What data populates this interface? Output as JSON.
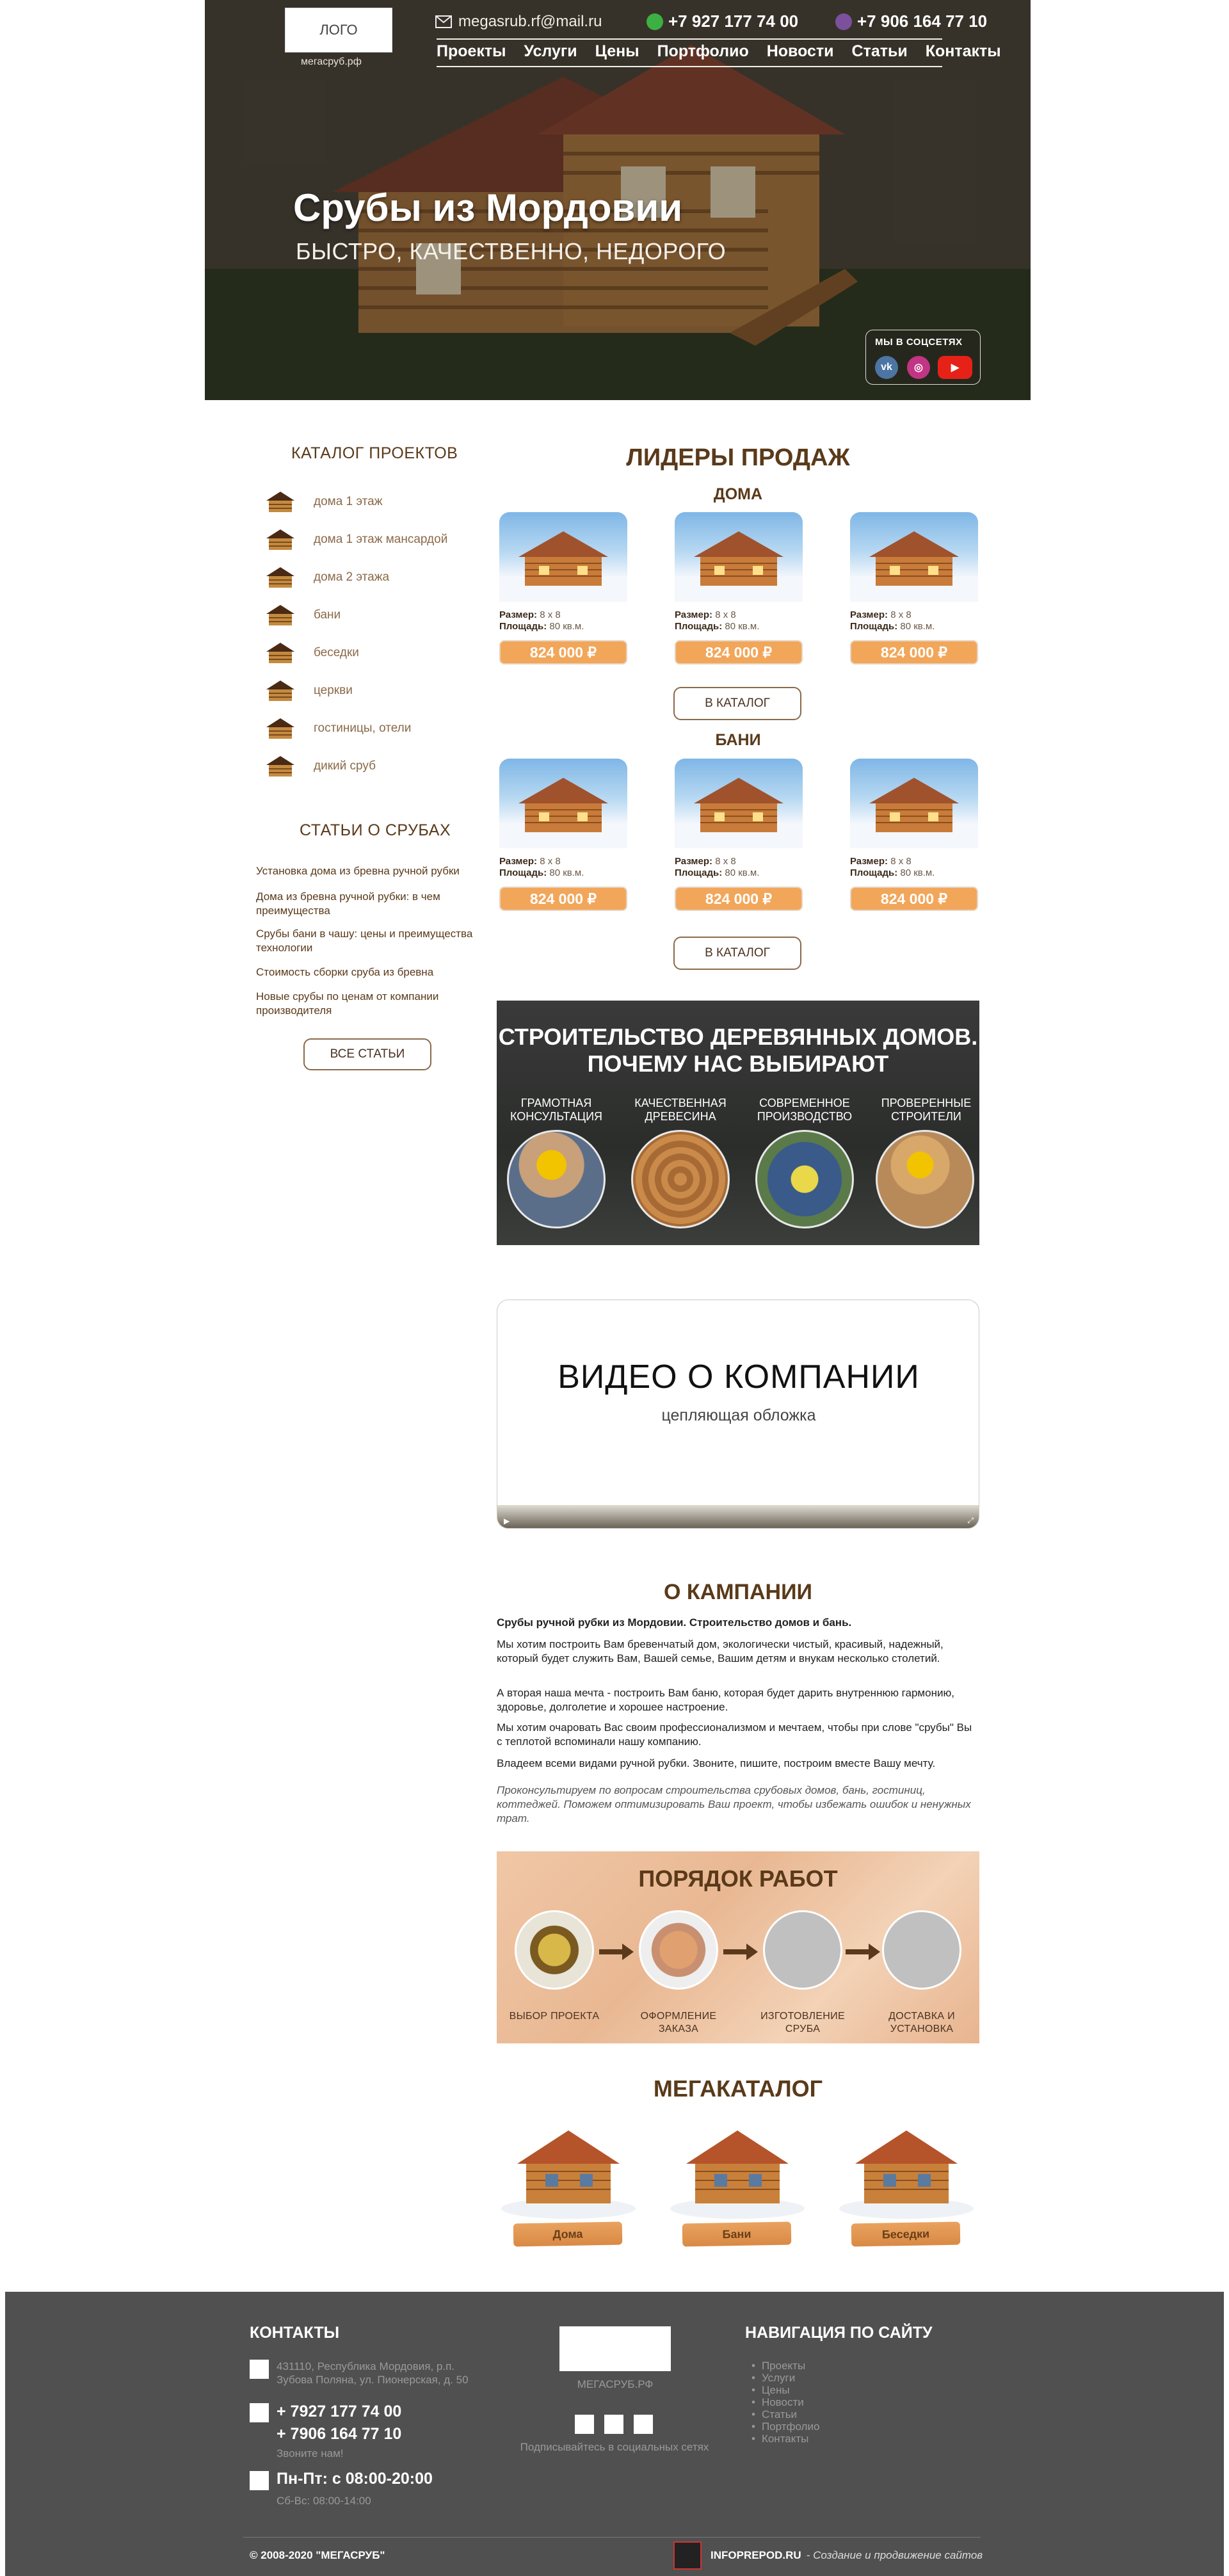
{
  "header": {
    "logo": "ЛОГО",
    "logo_caption": "мегасруб.рф",
    "email": "megasrub.rf@mail.ru",
    "phone1": "+7 927 177 74 00",
    "phone2": "+7 906 164 77 10",
    "nav": [
      "Проекты",
      "Услуги",
      "Цены",
      "Портфолио",
      "Новости",
      "Статьи",
      "Контакты"
    ],
    "title": "Срубы из Мордовии",
    "subtitle": "БЫСТРО, КАЧЕСТВЕННО, НЕДОРОГО",
    "social_title": "МЫ В СОЦСЕТЯХ",
    "social": [
      "vk-icon",
      "instagram-icon",
      "youtube-icon"
    ],
    "colors": {
      "vk": "#4c75a3",
      "instagram": "#c13584",
      "youtube": "#e62117",
      "whatsapp": "#3cb043",
      "viber": "#7b519d"
    }
  },
  "sidebar": {
    "catalog_title": "КАТАЛОГ ПРОЕКТОВ",
    "catalog": [
      "дома 1 этаж",
      "дома 1 этаж мансардой",
      "дома 2 этажа",
      "бани",
      "беседки",
      "церкви",
      "гостиницы, отели",
      "дикий сруб"
    ],
    "articles_title": "СТАТЬИ О СРУБАХ",
    "articles": [
      "Установка дома из бревна ручной рубки",
      "Дома из бревна ручной рубки: в чем преимущества",
      "Срубы бани в чашу: цены и преимущества технологии",
      "Стоимость сборки сруба из бревна",
      "Новые срубы по ценам от компании производителя"
    ],
    "all_articles": "ВСЕ СТАТЬИ"
  },
  "leaders": {
    "title": "ЛИДЕРЫ ПРОДАЖ",
    "houses_title": "ДОМА",
    "baths_title": "БАНИ",
    "size_label": "Размер:",
    "size_value": "8 х 8",
    "area_label": "Площадь:",
    "area_value": "80 кв.м.",
    "price": "824 000 ₽",
    "catalog_button": "В КАТАЛОГ"
  },
  "why": {
    "title_line1": "СТРОИТЕЛЬСТВО ДЕРЕВЯННЫХ ДОМОВ.",
    "title_line2": "ПОЧЕМУ НАС ВЫБИРАЮТ",
    "items": [
      {
        "l1": "ГРАМОТНАЯ",
        "l2": "КОНСУЛЬТАЦИЯ"
      },
      {
        "l1": "КАЧЕСТВЕННАЯ",
        "l2": "ДРЕВЕСИНА"
      },
      {
        "l1": "СОВРЕМЕННОЕ",
        "l2": "ПРОИЗВОДСТВО"
      },
      {
        "l1": "ПРОВЕРЕННЫЕ",
        "l2": "СТРОИТЕЛИ"
      }
    ]
  },
  "video": {
    "title": "ВИДЕО О КОМПАНИИ",
    "subtitle": "цепляющая обложка"
  },
  "about": {
    "title": "О КАМПАНИИ",
    "lead": "Срубы ручной рубки из Мордовии. Строительство домов и бань.",
    "p1": "Мы хотим построить Вам бревенчатый дом, экологически чистый, красивый, надежный, который будет служить Вам, Вашей семье, Вашим детям и внукам несколько столетий.",
    "p2": "А вторая наша мечта - построить Вам баню, которая будет дарить внутреннюю гармонию, здоровье, долголетие и хорошее настроение.",
    "p3": "Мы хотим очаровать Вас своим профессионализмом и мечтаем, чтобы при слове \"срубы\" Вы с теплотой вспоминали нашу компанию.",
    "p4": "Владеем всеми видами ручной рубки. Звоните, пишите, построим вместе Вашу мечту.",
    "p5": "Проконсультируем по вопросам строительства срубовых домов, бань, гостиниц, коттеджей. Поможем оптимизировать Ваш проект, чтобы избежать ошибок и ненужных трат."
  },
  "order": {
    "title": "ПОРЯДОК РАБОТ",
    "steps": [
      {
        "l1": "ВЫБОР ПРОЕКТА",
        "l2": ""
      },
      {
        "l1": "ОФОРМЛЕНИЕ",
        "l2": "ЗАКАЗА"
      },
      {
        "l1": "ИЗГОТОВЛЕНИЕ",
        "l2": "СРУБА"
      },
      {
        "l1": "ДОСТАВКА И",
        "l2": "УСТАНОВКА"
      }
    ]
  },
  "megacatalog": {
    "title": "МЕГАКАТАЛОГ",
    "items": [
      "Дома",
      "Бани",
      "Беседки"
    ]
  },
  "footer": {
    "contacts_title": "КОНТАКТЫ",
    "address": "431110, Республика Мордовия, р.п. Зубова Поляна, ул. Пионерская, д. 50",
    "phone1": "+ 7927 177 74 00",
    "phone2": "+ 7906 164 77 10",
    "call_us": "Звоните нам!",
    "hours": "Пн-Пт: с 08:00-20:00",
    "weekend": "Сб-Вс: 08:00-14:00",
    "brand": "МЕГАСРУБ.РФ",
    "subscribe": "Подписывайтесь в социальных сетях",
    "nav_title": "НАВИГАЦИЯ ПО САЙТУ",
    "nav": [
      "Проекты",
      "Услуги",
      "Цены",
      "Новости",
      "Статьи",
      "Портфолио",
      "Контакты"
    ],
    "copyright": "© 2008-2020 \"МЕГАСРУБ\"",
    "dev_name": "INFOPREPOD.RU",
    "dev_text": "- Создание и продвижение сайтов"
  }
}
